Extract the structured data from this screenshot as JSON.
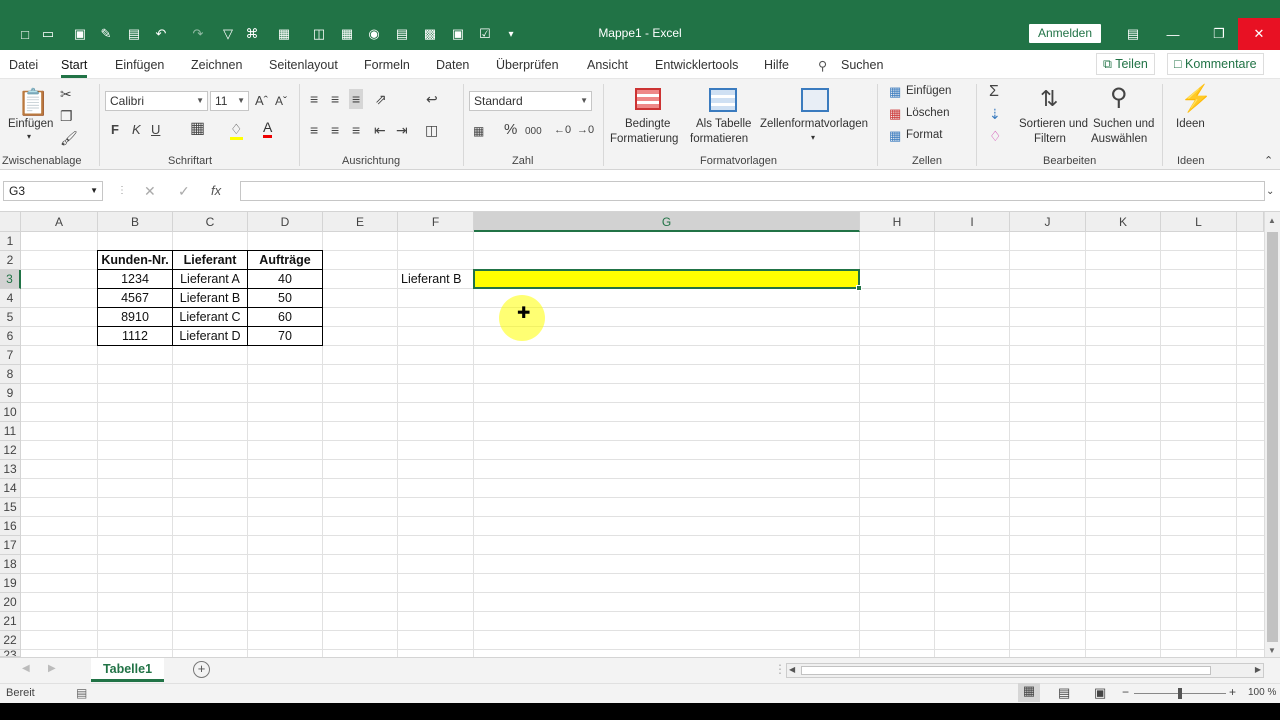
{
  "window": {
    "title": "Mappe1  -  Excel",
    "signin": "Anmelden"
  },
  "tabs": [
    "Datei",
    "Start",
    "Einfügen",
    "Zeichnen",
    "Seitenlayout",
    "Formeln",
    "Daten",
    "Überprüfen",
    "Ansicht",
    "Entwicklertools",
    "Hilfe"
  ],
  "search_label": "Suchen",
  "share_label": "Teilen",
  "comments_label": "Kommentare",
  "ribbon": {
    "paste": "Einfügen",
    "font_name": "Calibri",
    "font_size": "11",
    "bold": "F",
    "italic": "K",
    "underline": "U",
    "number_format": "Standard",
    "cond_format_1": "Bedingte",
    "cond_format_2": "Formatierung",
    "as_table_1": "Als Tabelle",
    "as_table_2": "formatieren",
    "cell_styles": "Zellenformatvorlagen",
    "cells_insert": "Einfügen",
    "cells_delete": "Löschen",
    "cells_format": "Format",
    "sort_1": "Sortieren und",
    "sort_2": "Filtern",
    "find_1": "Suchen und",
    "find_2": "Auswählen",
    "ideas": "Ideen",
    "groups": {
      "clipboard": "Zwischenablage",
      "font": "Schriftart",
      "alignment": "Ausrichtung",
      "number": "Zahl",
      "styles": "Formatvorlagen",
      "cells": "Zellen",
      "editing": "Bearbeiten",
      "ideas": "Ideen"
    }
  },
  "namebox": "G3",
  "columns": [
    "A",
    "B",
    "C",
    "D",
    "E",
    "F",
    "G",
    "H",
    "I",
    "J",
    "K",
    "L"
  ],
  "rows": [
    "1",
    "2",
    "3",
    "4",
    "5",
    "6",
    "7",
    "8",
    "9",
    "10",
    "11",
    "12",
    "13",
    "14",
    "15",
    "16",
    "17",
    "18",
    "19",
    "20",
    "21",
    "22",
    "23"
  ],
  "table": {
    "headers": [
      "Kunden-Nr.",
      "Lieferant",
      "Aufträge"
    ],
    "rows": [
      [
        "1234",
        "Lieferant A",
        "40"
      ],
      [
        "4567",
        "Lieferant B",
        "50"
      ],
      [
        "8910",
        "Lieferant C",
        "60"
      ],
      [
        "1112",
        "Lieferant D",
        "70"
      ]
    ]
  },
  "lookup_label": "Lieferant B",
  "highlight_color": "#ffff00",
  "sheet_tab": "Tabelle1",
  "status": {
    "ready": "Bereit",
    "zoom": "100 %"
  },
  "accent": "#217346"
}
